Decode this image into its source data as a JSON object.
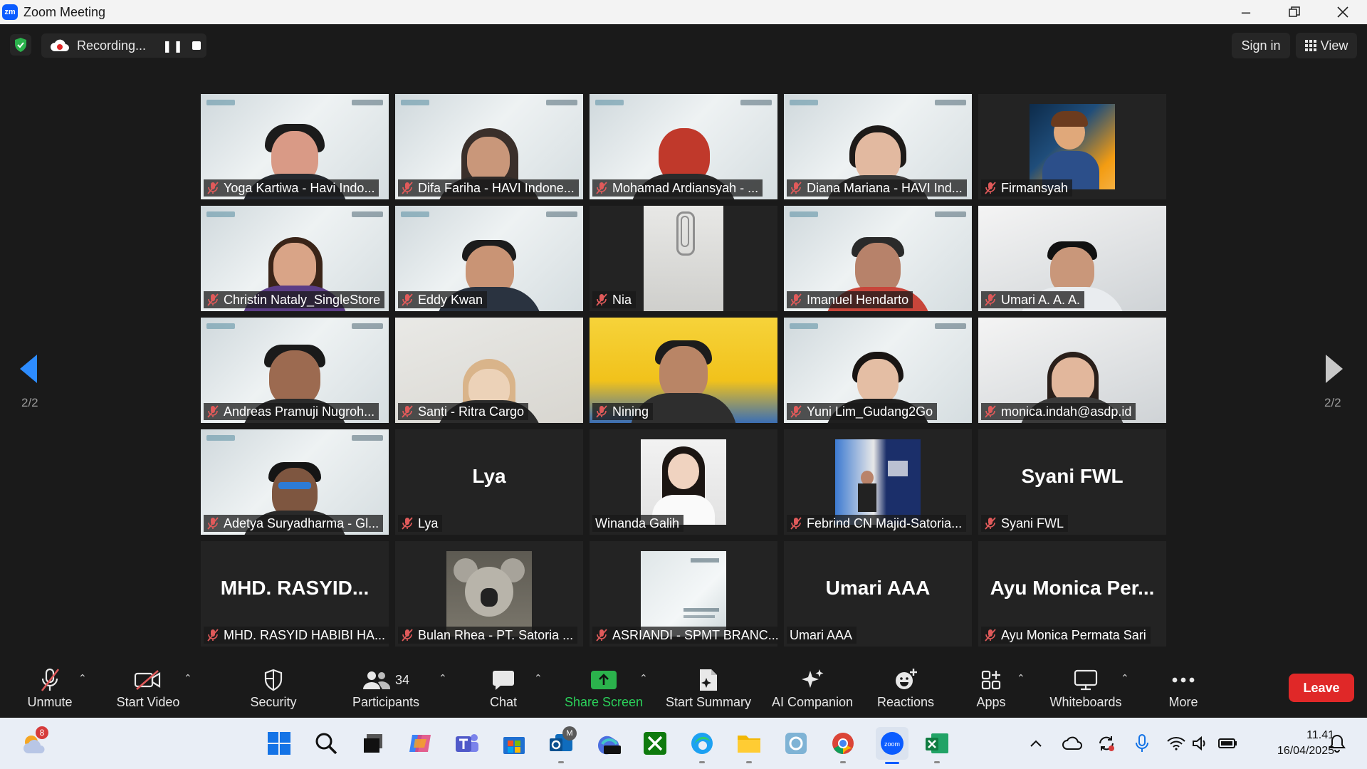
{
  "window": {
    "title": "Zoom Meeting",
    "logo": "zm"
  },
  "topbar": {
    "recording_label": "Recording...",
    "sign_in": "Sign in",
    "view": "View"
  },
  "pager": {
    "left": "2/2",
    "right": "2/2"
  },
  "participants": [
    {
      "label": "Yoga Kartiwa - Havi Indo...",
      "muted": true
    },
    {
      "label": "Difa Fariha - HAVI Indone...",
      "muted": true
    },
    {
      "label": "Mohamad Ardiansyah - ...",
      "muted": true
    },
    {
      "label": "Diana Mariana - HAVI Ind...",
      "muted": true
    },
    {
      "label": "Firmansyah",
      "muted": true
    },
    {
      "label": "Christin Nataly_SingleStore",
      "muted": true
    },
    {
      "label": "Eddy Kwan",
      "muted": true
    },
    {
      "label": "Nia",
      "muted": true
    },
    {
      "label": "Imanuel Hendarto",
      "muted": true
    },
    {
      "label": "Umari A. A. A.",
      "muted": true
    },
    {
      "label": "Andreas Pramuji Nugroh...",
      "muted": true
    },
    {
      "label": "Santi - Ritra Cargo",
      "muted": true
    },
    {
      "label": "Nining",
      "muted": true
    },
    {
      "label": "Yuni Lim_Gudang2Go",
      "muted": true
    },
    {
      "label": "monica.indah@asdp.id",
      "muted": true
    },
    {
      "label": "Adetya Suryadharma - Gl...",
      "muted": true
    },
    {
      "label": "Lya",
      "muted": true,
      "big": "Lya"
    },
    {
      "label": "Winanda Galih",
      "muted": false
    },
    {
      "label": "Febrind CN Majid-Satoria...",
      "muted": true
    },
    {
      "label": "Syani FWL",
      "muted": true,
      "big": "Syani FWL"
    },
    {
      "label": "MHD. RASYID HABIBI HA...",
      "muted": true,
      "big": "MHD. RASYID..."
    },
    {
      "label": "Bulan Rhea - PT. Satoria ...",
      "muted": true
    },
    {
      "label": "ASRIANDI - SPMT BRANC...",
      "muted": true
    },
    {
      "label": "Umari AAA",
      "muted": false,
      "big": "Umari AAA"
    },
    {
      "label": "Ayu Monica Permata Sari",
      "muted": true,
      "big": "Ayu Monica Per..."
    }
  ],
  "toolbar": {
    "unmute": "Unmute",
    "start_video": "Start Video",
    "security": "Security",
    "participants": "Participants",
    "participants_count": "34",
    "chat": "Chat",
    "share_screen": "Share Screen",
    "start_summary": "Start Summary",
    "ai_companion": "AI Companion",
    "reactions": "Reactions",
    "apps": "Apps",
    "whiteboards": "Whiteboards",
    "more": "More",
    "leave": "Leave"
  },
  "taskbar": {
    "weather_badge": "8",
    "teams_badge": "M",
    "time": "11.41",
    "date": "16/04/2025"
  },
  "colors": {
    "accent_blue": "#0b5cff",
    "share_green": "#2bb24c",
    "leave_red": "#e02828",
    "mute_red": "#e05a5a"
  }
}
